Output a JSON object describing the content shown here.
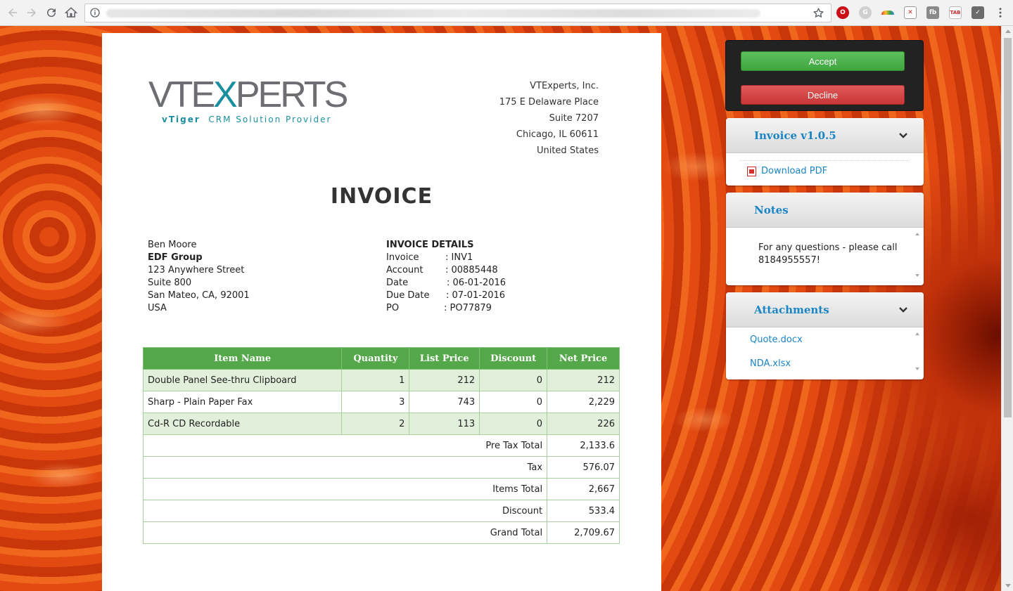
{
  "browser": {
    "back_icon": "arrow-left-icon",
    "forward_icon": "arrow-right-icon",
    "reload_icon": "reload-icon",
    "home_icon": "home-icon",
    "info_icon": "info-icon",
    "star_icon": "star-icon",
    "menu_icon": "more-vert-icon",
    "extensions": [
      "opera-icon",
      "g-icon",
      "rainbow-icon",
      "x-icon",
      "fb-icon",
      "tab-icon",
      "check-icon"
    ]
  },
  "colors": {
    "accent_green": "#55a849",
    "accept_green": "#4cb44c",
    "decline_red": "#d54545",
    "link_blue": "#1a84c4",
    "logo_teal": "#1a8fa0",
    "logo_gray": "#6d6e71"
  },
  "invoice": {
    "logo": {
      "word_left": "VTE",
      "word_x": "X",
      "word_right": "PERTS",
      "tag_left": "vTiger",
      "tag_right": "CRM Solution Provider"
    },
    "company": {
      "name": "VTExperts, Inc.",
      "address1": "175 E Delaware Place",
      "address2": "Suite 7207",
      "city": "Chicago, IL 60611",
      "country": "United States"
    },
    "title": "INVOICE",
    "bill_to": {
      "name": "Ben Moore",
      "company": "EDF Group",
      "street": "123 Anywhere Street",
      "suite": "Suite 800",
      "city": "San Mateo, CA, 92001",
      "country": "USA"
    },
    "details": {
      "heading": "INVOICE DETAILS",
      "rows": [
        {
          "label": "Invoice",
          "value": ": INV1"
        },
        {
          "label": "Account",
          "value": ": 00885448"
        },
        {
          "label": "Date",
          "value": ": 06-01-2016"
        },
        {
          "label": "Due Date",
          "value": ": 07-01-2016"
        },
        {
          "label": "PO",
          "value": ": PO77879"
        }
      ]
    },
    "table": {
      "headers": [
        "Item Name",
        "Quantity",
        "List Price",
        "Discount",
        "Net Price"
      ],
      "rows": [
        [
          "Double Panel See-thru Clipboard",
          "1",
          "212",
          "0",
          "212"
        ],
        [
          "Sharp - Plain Paper Fax",
          "3",
          "743",
          "0",
          "2,229"
        ],
        [
          "Cd-R CD Recordable",
          "2",
          "113",
          "0",
          "226"
        ]
      ],
      "totals": [
        {
          "label": "Pre Tax Total",
          "value": "2,133.6"
        },
        {
          "label": "Tax",
          "value": "576.07"
        },
        {
          "label": "Items Total",
          "value": "2,667"
        },
        {
          "label": "Discount",
          "value": "533.4"
        },
        {
          "label": "Grand Total",
          "value": "2,709.67"
        }
      ]
    }
  },
  "sidebar": {
    "accept_label": "Accept",
    "decline_label": "Decline",
    "version_panel": {
      "title": "Invoice v1.0.5",
      "download_label": "Download PDF"
    },
    "notes_panel": {
      "title": "Notes",
      "text": "For any questions - please call 8184955557!"
    },
    "attachments_panel": {
      "title": "Attachments",
      "files": [
        "Quote.docx",
        "NDA.xlsx"
      ]
    }
  }
}
